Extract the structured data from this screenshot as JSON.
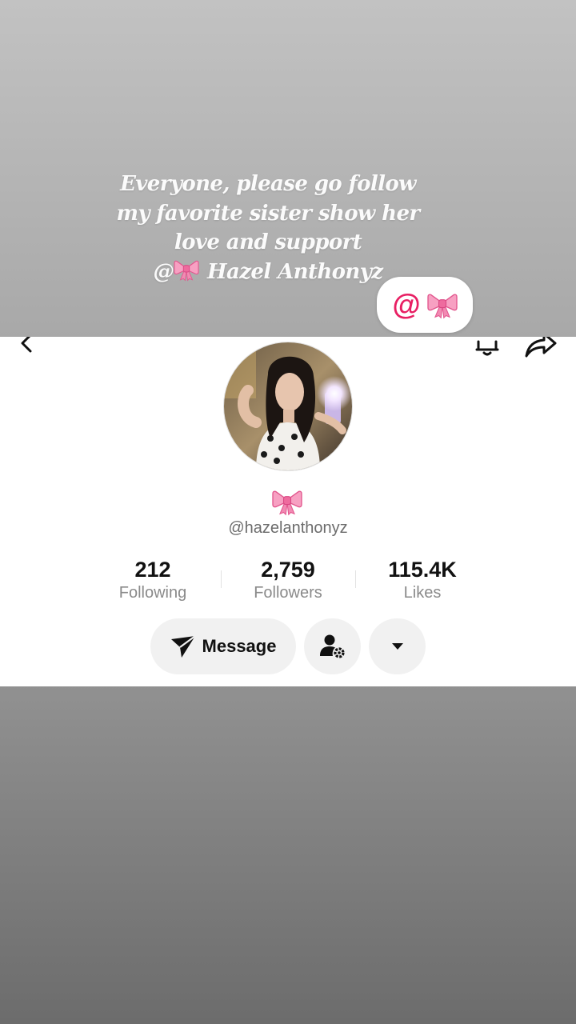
{
  "story": {
    "lines": [
      "Everyone, please go follow",
      "my favorite sister show her",
      "love and support",
      "Hazel Anthonyz"
    ],
    "mention_prefix": "@",
    "mention_icon": "ribbon-bow-icon"
  },
  "sticker": {
    "at_symbol": "@",
    "icon": "ribbon-bow-icon",
    "accent_color": "#e81f63"
  },
  "profile": {
    "display_name_icon": "ribbon-bow-icon",
    "username": "@hazelanthonyz",
    "stats": [
      {
        "value": "212",
        "label": "Following"
      },
      {
        "value": "2,759",
        "label": "Followers"
      },
      {
        "value": "115.4K",
        "label": "Likes"
      }
    ],
    "buttons": {
      "message_label": "Message",
      "message_icon": "send-icon",
      "friends_icon": "person-settings-icon",
      "more_icon": "caret-down-icon"
    },
    "header_icons": [
      "chevron-left-icon",
      "bell-icon",
      "share-icon"
    ]
  },
  "colors": {
    "bow_pink": "#f07ea6",
    "text_primary": "#111111",
    "text_secondary": "#8a8a8a"
  }
}
